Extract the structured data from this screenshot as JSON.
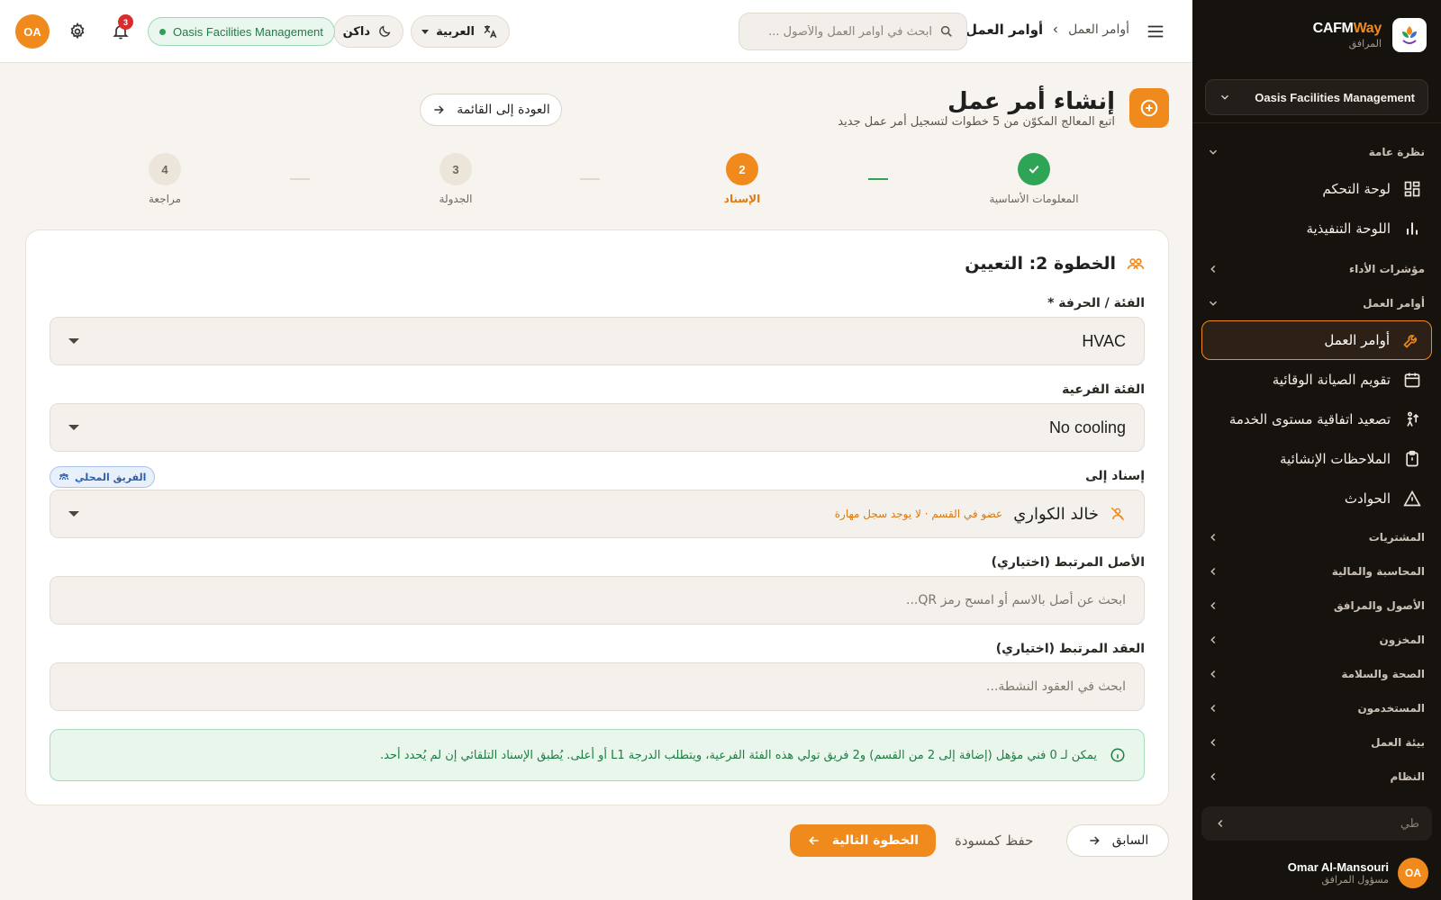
{
  "sidebar": {
    "brand": {
      "name_main": "CAFM",
      "name_accent": "Way",
      "subtitle": "المرافق"
    },
    "org_selector": "Oasis Facilities Management",
    "groups": {
      "overview": "نظرة عامة",
      "kpi": "مؤشرات الأداء",
      "work_orders": "أوامر العمل",
      "procurement": "المشتريات",
      "accounting": "المحاسبة والمالية",
      "assets": "الأصول والمرافق",
      "inventory": "المخزون",
      "hse": "الصحة والسلامة",
      "users": "المستخدمون",
      "workplace": "بيئة العمل",
      "system": "النظام"
    },
    "items": {
      "dashboard": "لوحة التحكم",
      "executive": "اللوحة التنفيذية",
      "work_orders": "أوامر العمل",
      "pm_calendar": "تقويم الصيانة الوقائية",
      "sla_escalation": "تصعيد اتفاقية مستوى الخدمة",
      "construction_notes": "الملاحظات الإنشائية",
      "incidents": "الحوادث"
    },
    "collapse_label": "طي",
    "user": {
      "initials": "OA",
      "name": "Omar Al-Mansouri",
      "role": "مسؤول المرافق"
    }
  },
  "topbar": {
    "breadcrumb": {
      "parent": "أوامر العمل",
      "current": "أوامر العمل"
    },
    "search_placeholder": "ابحث في أوامر العمل والأصول ...",
    "language": "العربية",
    "theme": "داكن",
    "org_chip": "Oasis Facilities Management",
    "notifications_count": "3",
    "avatar_initials": "OA"
  },
  "page": {
    "title": "إنشاء أمر عمل",
    "subtitle": "اتبع المعالج المكوّن من 5 خطوات لتسجيل أمر عمل جديد",
    "back_label": "العودة إلى القائمة"
  },
  "stepper": {
    "steps": [
      {
        "number": "1",
        "label": "المعلومات الأساسية",
        "status": "done"
      },
      {
        "number": "2",
        "label": "الإسناد",
        "status": "current"
      },
      {
        "number": "3",
        "label": "الجدولة",
        "status": "pending"
      },
      {
        "number": "4",
        "label": "مراجعة",
        "status": "pending"
      }
    ]
  },
  "form": {
    "section_title": "الخطوة 2: التعيين",
    "category": {
      "label": "الفئة / الحرفة",
      "required_mark": "*",
      "value": "HVAC"
    },
    "subcategory": {
      "label": "الفئة الفرعية",
      "value": "No cooling"
    },
    "assign_to": {
      "label": "إسناد إلى",
      "team_chip": "الفريق المحلي",
      "assignee_name": "خالد الكواري",
      "assignee_note": "عضو في القسم · لا يوجد سجل مهارة"
    },
    "linked_asset": {
      "label": "الأصل المرتبط (اختياري)",
      "placeholder": "ابحث عن أصل بالاسم أو امسح رمز QR..."
    },
    "linked_contract": {
      "label": "العقد المرتبط (اختياري)",
      "placeholder": "ابحث في العقود النشطة..."
    },
    "info_message": "يمكن لـ 0 فني مؤهل (إضافة إلى 2 من القسم) و2 فريق تولي هذه الفئة الفرعية، ويتطلب الدرجة L1 أو أعلى. يُطبق الإسناد التلقائي إن لم يُحدد أحد."
  },
  "actions": {
    "previous": "السابق",
    "save_draft": "حفظ كمسودة",
    "next": "الخطوة التالية"
  },
  "colors": {
    "accent": "#f08a1c",
    "sidebar_bg": "#16130f",
    "success": "#2ea556",
    "info_bg": "#e8f6ec"
  }
}
